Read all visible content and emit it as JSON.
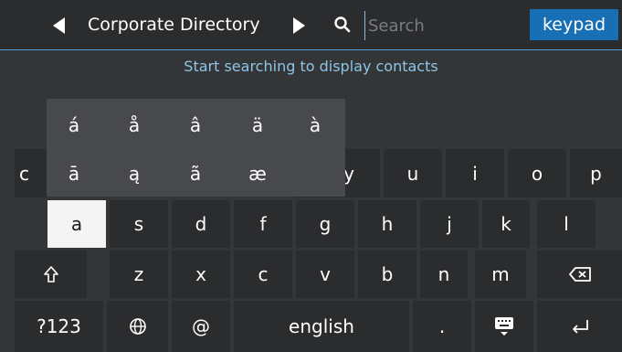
{
  "header": {
    "title": "Corporate Directory",
    "search_placeholder": "Search",
    "keypad_label": "keypad"
  },
  "hint": "Start searching to display contacts",
  "accent_popup": {
    "row1": [
      "á",
      "å",
      "â",
      "ä",
      "à"
    ],
    "row2": [
      "ā",
      "ą",
      "ã",
      "æ"
    ]
  },
  "keyboard": {
    "row1": [
      "c",
      "y",
      "u",
      "i",
      "o",
      "p"
    ],
    "row2": [
      "a",
      "s",
      "d",
      "f",
      "g",
      "h",
      "j",
      "k",
      "l"
    ],
    "row3": [
      "z",
      "x",
      "c",
      "v",
      "b",
      "n",
      "m"
    ],
    "row4": {
      "symbols": "?123",
      "at": "@",
      "space": "english",
      "period": "."
    }
  },
  "icons": {
    "prev": "triangle-left-icon",
    "next": "triangle-right-icon",
    "search": "search-icon",
    "shift": "shift-icon",
    "backspace": "backspace-icon",
    "globe": "globe-icon",
    "keyboard": "keyboard-hide-icon",
    "enter": "enter-icon"
  },
  "colors": {
    "accent": "#176fb5",
    "hint": "#8ec5e6"
  }
}
